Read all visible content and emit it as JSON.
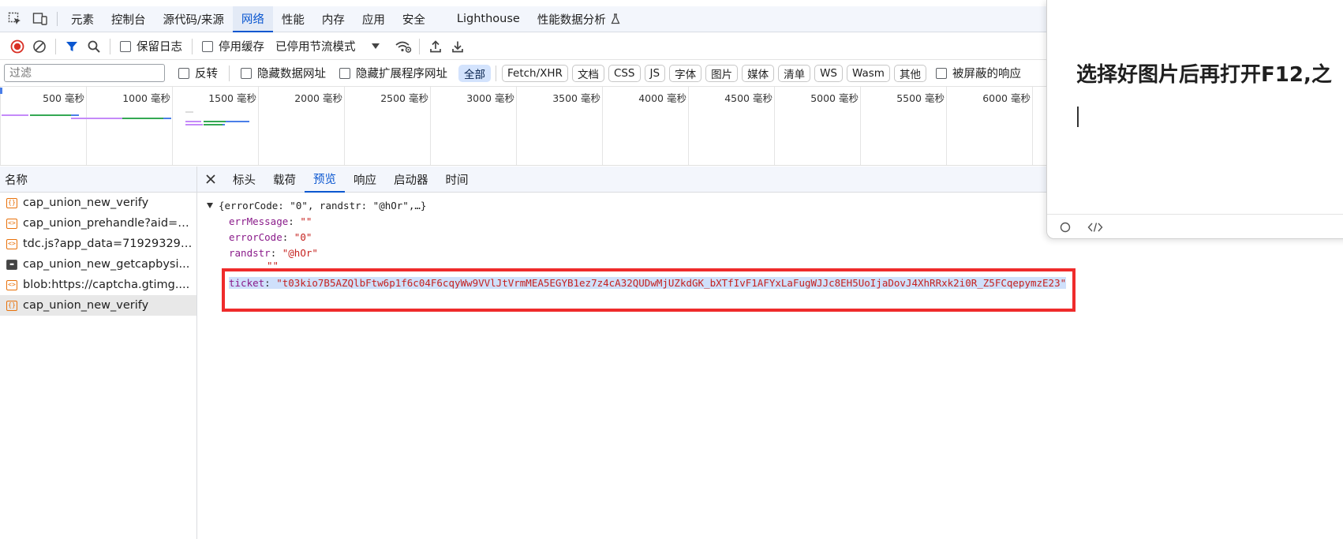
{
  "devtools": {
    "tabs": [
      "元素",
      "控制台",
      "源代码/来源",
      "网络",
      "性能",
      "内存",
      "应用",
      "安全",
      "Lighthouse",
      "性能数据分析"
    ],
    "active_tab": "网络"
  },
  "toolbar": {
    "preserve_log": "保留日志",
    "disable_cache": "停用缓存",
    "throttling": "已停用节流模式"
  },
  "filterbar": {
    "placeholder": "过滤",
    "invert": "反转",
    "hide_data_urls": "隐藏数据网址",
    "hide_extension_urls": "隐藏扩展程序网址",
    "types": [
      "全部",
      "Fetch/XHR",
      "文档",
      "CSS",
      "JS",
      "字体",
      "图片",
      "媒体",
      "清单",
      "WS",
      "Wasm",
      "其他"
    ],
    "blocked": "被屏蔽的响应"
  },
  "timeline": {
    "ticks": [
      "500 毫秒",
      "1000 毫秒",
      "1500 毫秒",
      "2000 毫秒",
      "2500 毫秒",
      "3000 毫秒",
      "3500 毫秒",
      "4000 毫秒",
      "4500 毫秒",
      "5000 毫秒",
      "5500 毫秒",
      "6000 毫秒"
    ]
  },
  "requests": {
    "header": "名称",
    "rows": [
      {
        "name": "cap_union_new_verify",
        "type": "xhr"
      },
      {
        "name": "cap_union_prehandle?aid=1...",
        "type": "script"
      },
      {
        "name": "tdc.js?app_data=719293292...",
        "type": "script"
      },
      {
        "name": "cap_union_new_getcapbysi...",
        "type": "image"
      },
      {
        "name": "blob:https://captcha.gtimg....",
        "type": "script"
      },
      {
        "name": "cap_union_new_verify",
        "type": "xhr"
      }
    ],
    "selected_index": 5
  },
  "detail": {
    "tabs": [
      "标头",
      "载荷",
      "预览",
      "响应",
      "启动器",
      "时间"
    ],
    "active_tab": "预览",
    "summary": "{errorCode: \"0\", randstr: \"@hOr\",…}",
    "fields": {
      "errMessage_key": "errMessage",
      "errMessage_val": "\"\"",
      "errorCode_key": "errorCode",
      "errorCode_val": "\"0\"",
      "randstr_key": "randstr",
      "randstr_val": "\"@hOr\"",
      "partial_val": "\"\"",
      "ticket_key": "ticket",
      "ticket_val": "\"t03kio7B5AZQlbFtw6p1f6c04F6cqyWw9VVlJtVrmMEA5EGYB1ez7z4cA32QUDwMjUZkdGK_bXTfIvF1AFYxLaFugWJJc8EH5UoIjaDovJ4XhRRxk2i0R_Z5FCqepymzE23\""
    }
  },
  "overlay": {
    "title": "选择好图片后再打开F12,之"
  },
  "colors": {
    "accent": "#0b57d0",
    "highlight_box": "#ef2b2b",
    "json_key": "#8a1b8a",
    "json_string": "#c5221f"
  }
}
